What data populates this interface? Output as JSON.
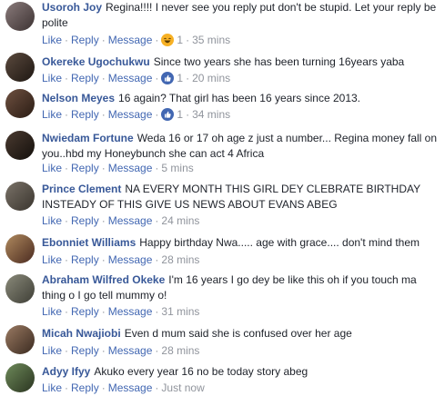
{
  "actions": {
    "like": "Like",
    "reply": "Reply",
    "message": "Message",
    "sep": "·"
  },
  "comments": [
    {
      "author": "Usoroh Joy",
      "text": "Regina!!!! I never see you reply put don't be stupid. Let your reply be polite",
      "reaction_icon": "haha-icon",
      "reaction_count": "1",
      "time": "35 mins"
    },
    {
      "author": "Okereke Ugochukwu",
      "text": "Since two years she has been turning 16years yaba",
      "reaction_icon": "like-icon",
      "reaction_count": "1",
      "time": "20 mins"
    },
    {
      "author": "Nelson Meyes",
      "text": "16 again? That girl has been 16 years since 2013.",
      "reaction_icon": "like-icon",
      "reaction_count": "1",
      "time": "34 mins"
    },
    {
      "author": "Nwiedam Fortune",
      "text": "Weda 16 or 17 oh age z just a number... Regina money fall on you..hbd my Honeybunch she can act 4 Africa",
      "time": "5 mins"
    },
    {
      "author": "Prince Clement",
      "text": "NA EVERY MONTH THIS GIRL DEY CLEBRATE BIRTHDAY INSTEADY OF THIS GIVE US NEWS ABOUT EVANS ABEG",
      "time": "24 mins"
    },
    {
      "author": "Ebonniet Williams",
      "text": "Happy birthday Nwa..... age with grace.... don't mind them",
      "time": "28 mins"
    },
    {
      "author": "Abraham Wilfred Okeke",
      "text": "I'm 16 years I go dey be like this oh if you touch ma thing o I go tell mummy o!",
      "time": "31 mins"
    },
    {
      "author": "Micah Nwajiobi",
      "text": "Even d mum said she is confused over her age",
      "time": "28 mins"
    },
    {
      "author": "Adyy Ifyy",
      "text": "Akuko every year 16 no be today story abeg",
      "time": "Just now"
    }
  ],
  "colors": {
    "author": "#385898",
    "link": "#4267b2",
    "meta": "#90949c",
    "text": "#1d2129"
  }
}
